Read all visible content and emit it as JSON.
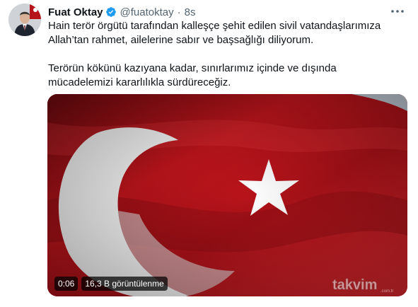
{
  "author": {
    "name": "Fuat Oktay",
    "handle": "@fuatoktay",
    "separator": "·",
    "time": "8s",
    "verified": true,
    "avatar_icon": "profile-photo"
  },
  "tweet": {
    "paragraph_1": "Hain terör örgütü tarafından kalleşçe şehit edilen sivil vatandaşlarımıza Allah’tan rahmet, ailelerine sabır ve başsağlığı diliyorum.",
    "paragraph_2": "Terörün kökünü kazıyana kadar, sınırlarımız içinde ve dışında mücadelemizi kararlılıkla sürdüreceğiz."
  },
  "media": {
    "type": "video",
    "duration": "0:06",
    "views": "16,3 B görüntülenme",
    "subject": "turkish-flag",
    "watermark": "takvim.com.tr"
  },
  "colors": {
    "name": "#0f1419",
    "secondary": "#536471",
    "verified": "#1d9bf0",
    "flag_red": "#c8161d",
    "flag_white": "#ffffff"
  },
  "icons": {
    "more": "more-icon",
    "verified": "verified-badge-icon"
  }
}
